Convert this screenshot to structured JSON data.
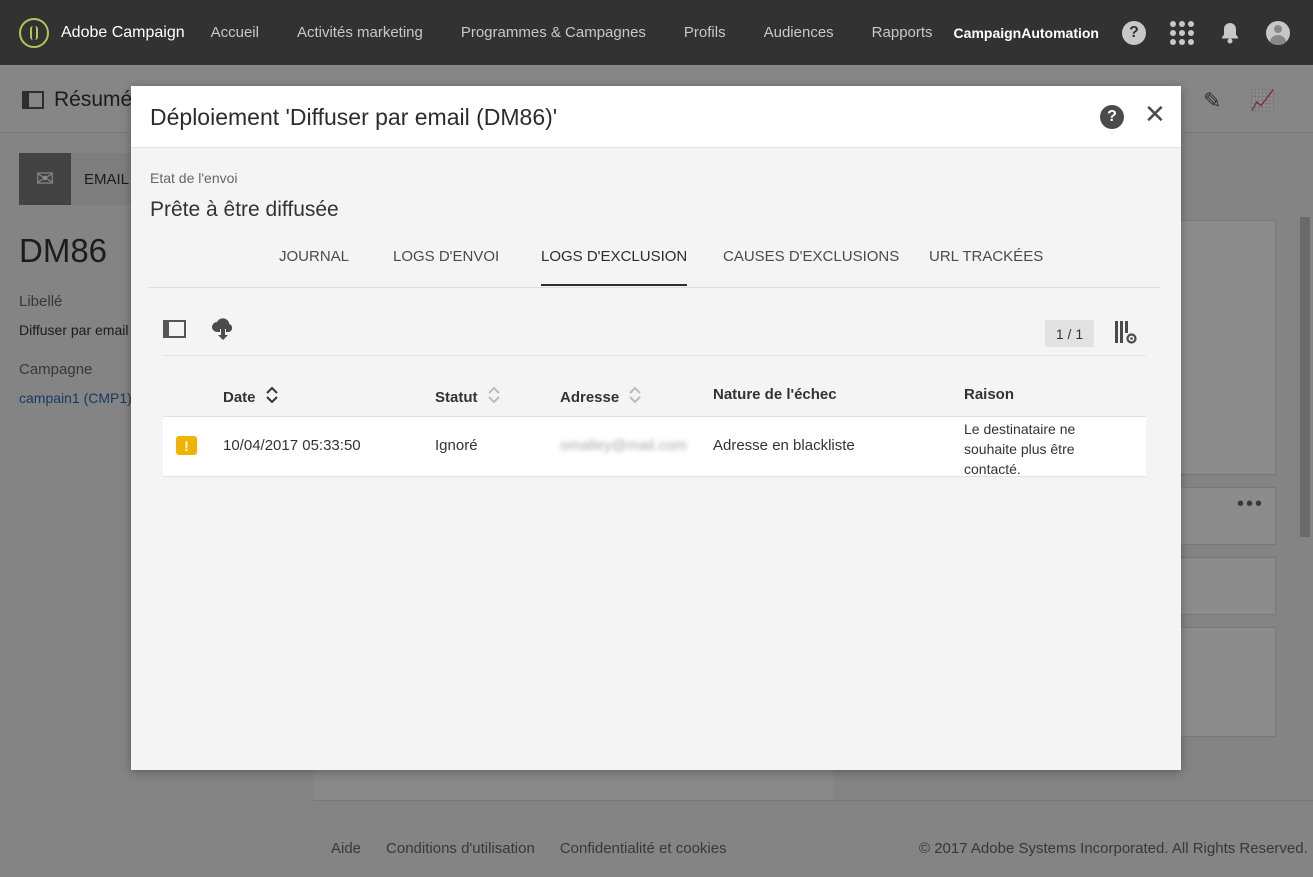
{
  "app": {
    "name": "Adobe Campaign",
    "nav": [
      "Accueil",
      "Activités marketing",
      "Programmes & Campagnes",
      "Profils",
      "Audiences",
      "Rapports"
    ],
    "account": "CampaignAutomation",
    "help_glyph": "?"
  },
  "page": {
    "title": "Résumé",
    "card_label": "EMAIL",
    "delivery_code": "DM86",
    "label_title": "Libellé",
    "label_value": "Diffuser par email",
    "campaign_title": "Campagne",
    "campaign_value": "campain1 (CMP1)",
    "footer_links": [
      "Aide",
      "Conditions d'utilisation",
      "Confidentialité et cookies"
    ],
    "copyright": "© 2017 Adobe Systems Incorporated. All Rights Reserved."
  },
  "modal": {
    "title": "Déploiement 'Diffuser par email (DM86)'",
    "state_label": "Etat de l'envoi",
    "state_value": "Prête à être diffusée",
    "tabs": [
      "JOURNAL",
      "LOGS D'ENVOI",
      "LOGS D'EXCLUSION",
      "CAUSES D'EXCLUSIONS",
      "URL TRACKÉES"
    ],
    "active_tab": "LOGS D'EXCLUSION",
    "pager": "1 / 1",
    "columns": [
      "Date",
      "Statut",
      "Adresse",
      "Nature de l'échec",
      "Raison"
    ],
    "rows": [
      {
        "date": "10/04/2017 05:33:50",
        "status": "Ignoré",
        "address": "omalley@mail.com",
        "failure": "Adresse en blackliste",
        "reason": "Le destinataire ne souhaite plus être contacté."
      }
    ],
    "warning_color": "#f0b400"
  }
}
